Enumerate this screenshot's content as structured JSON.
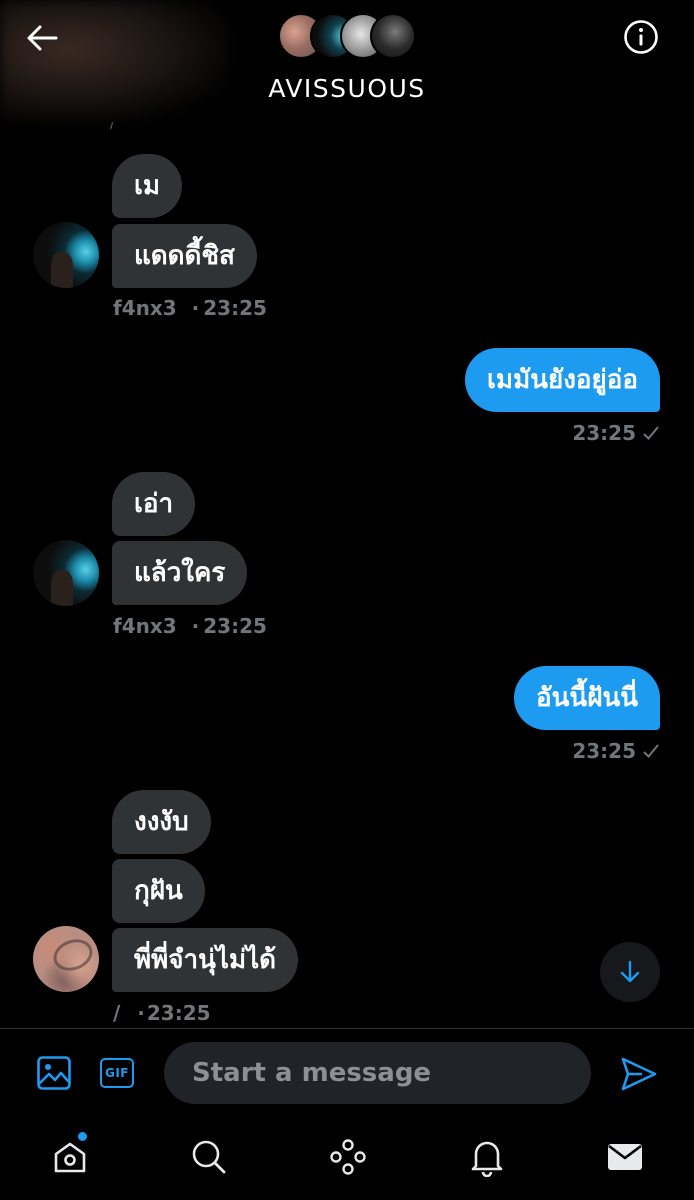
{
  "header": {
    "title": "AVISSUOUS",
    "icons": {
      "back": "arrow-left-icon",
      "info": "info-circle-icon"
    }
  },
  "messages": [
    {
      "direction": "in",
      "text": "เม"
    },
    {
      "direction": "in",
      "text": "แดดดี้ชิส"
    },
    {
      "direction": "in_meta",
      "sender": "f4nx3",
      "time": "23:25"
    },
    {
      "direction": "out",
      "text": "เมมันยังอยู่อ่อ",
      "time": "23:25"
    },
    {
      "direction": "in",
      "text": "เอ่า"
    },
    {
      "direction": "in",
      "text": "แล้วใคร"
    },
    {
      "direction": "in_meta",
      "sender": "f4nx3",
      "time": "23:25"
    },
    {
      "direction": "out",
      "text": "อันนี้ฝันนี่",
      "time": "23:25"
    },
    {
      "direction": "in",
      "text": "งงงับ"
    },
    {
      "direction": "in",
      "text": "กุฝัน"
    },
    {
      "direction": "in",
      "text": "พี่พี่จำนุ่ไม่ได้"
    },
    {
      "direction": "in_meta",
      "sender": "/",
      "time": "23:25"
    }
  ],
  "meta_separator": "·",
  "composer": {
    "placeholder": "Start a message",
    "gif_label": "GIF",
    "icons": {
      "image": "image-icon",
      "send": "send-icon"
    }
  },
  "nav": {
    "items": [
      "home-icon",
      "search-icon",
      "spaces-icon",
      "bell-icon",
      "mail-icon"
    ],
    "home_has_notification": true
  },
  "colors": {
    "accent": "#1d9bf0",
    "incoming_bubble": "#2f3336",
    "background": "#000000",
    "muted_text": "#71767b"
  }
}
